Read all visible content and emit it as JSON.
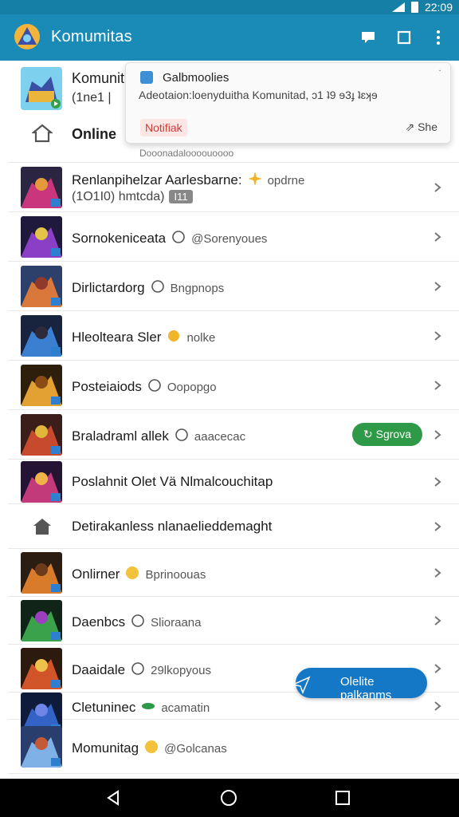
{
  "status": {
    "time": "22:09"
  },
  "app_bar": {
    "title": "Komumitas",
    "logo": "app-logo-icon",
    "actions": [
      "chat-icon",
      "square-icon",
      "more-vert-icon"
    ]
  },
  "top_item": {
    "name": "Komunit",
    "sub": "(1ne1 |",
    "online_label": "Online"
  },
  "popup": {
    "title": "Galbmoolies",
    "body": "Adeotaion:loenyduitha Komunitad, ɔ1 ʇ9 ɘ3ɟ ʇɛʞɘ",
    "tag": "Notifiak",
    "share": "She",
    "menu": "˙",
    "sub": "Dooonadaloooouoooo"
  },
  "rows": [
    {
      "title": "Renlanpihelzar Aarlesbarne:",
      "title_emoji": "sparkle",
      "title_extra": "opdrne",
      "sub": "(1O1I0) hmtcda)",
      "badge": "I11"
    },
    {
      "title": "Sornokeniceata",
      "meta": "@Sorenyoues"
    },
    {
      "title": "Dirlictardorg",
      "meta": "Bngpnops"
    },
    {
      "title": "Hleolteara Sler",
      "meta": "nolke"
    },
    {
      "title": "Posteiaiods",
      "meta": "Oopopgo"
    },
    {
      "title": "Braladraml allek",
      "meta": "aaacecac",
      "action": "Sgrova"
    },
    {
      "title": "Poslahnit Olet Vä Nlmalcouchitap"
    },
    {
      "title": "Detirakanless nlanaelieddemaght"
    },
    {
      "title": "Onlirner",
      "meta": "Bprinoouas"
    },
    {
      "title": "Daenbcs",
      "meta": "Slioraana"
    },
    {
      "title": "Daaidale",
      "meta": "29lkopyous"
    },
    {
      "title": "Cletuninec",
      "meta": "acamatin"
    },
    {
      "title": "Momunitag",
      "meta": "@Golcanas"
    }
  ],
  "fab": {
    "label": "Olelite palkanms"
  },
  "nav": [
    "back-icon",
    "home-icon",
    "recents-icon"
  ]
}
